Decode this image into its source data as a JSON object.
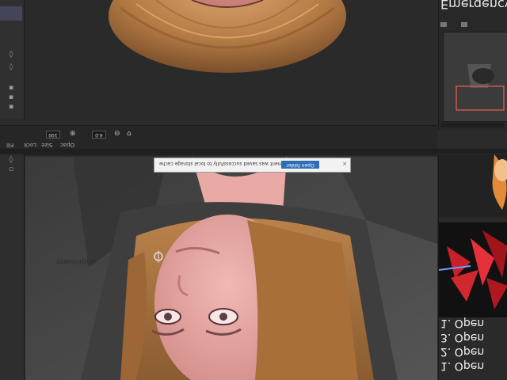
{
  "right_panel": {
    "title": "Emergency G",
    "open_items": [
      "1. Open",
      "3. Open",
      "2. Open",
      "1. Open"
    ]
  },
  "dialog": {
    "message": "Document was saved successfully to local storage cache",
    "button_label": "Open folder",
    "close": "×"
  },
  "toolbar": {
    "zoom_value": "100",
    "size_value": "4.0",
    "labels": [
      "Fill",
      "Lock",
      "Size",
      "Opac"
    ]
  },
  "canvas": {
    "watermark": "anoniswer"
  },
  "colors": {
    "panel_bg": "#2b2b2b",
    "accent": "#2f6db5"
  },
  "icons": [
    "zoom-in-icon",
    "zoom-out-icon",
    "visibility-icon",
    "lock-icon"
  ]
}
